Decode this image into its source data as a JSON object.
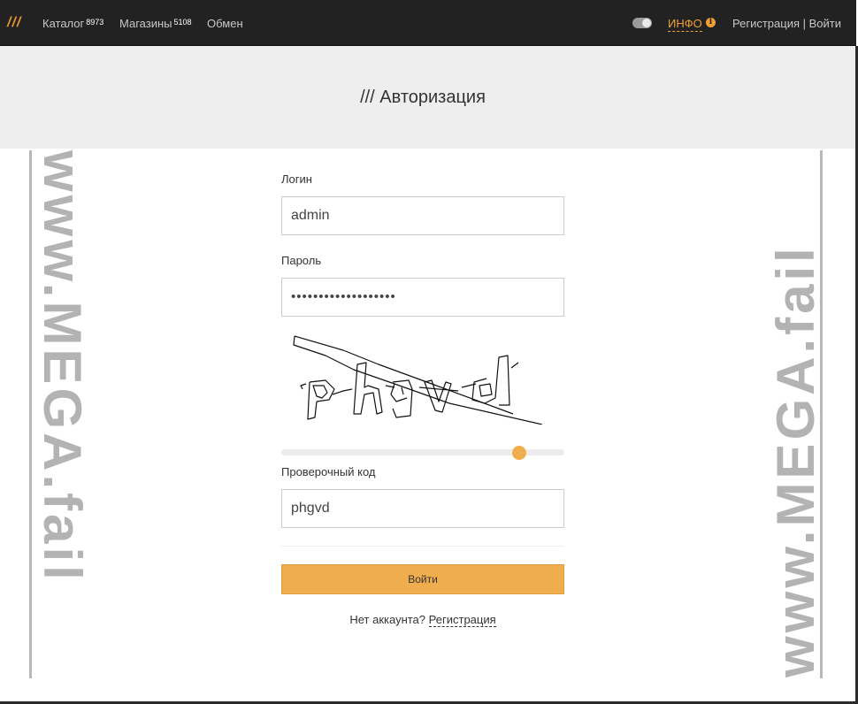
{
  "navbar": {
    "logo": "///",
    "catalog_label": "Каталог",
    "catalog_count": "8973",
    "shops_label": "Магазины",
    "shops_count": "5108",
    "exchange_label": "Обмен",
    "info_label": "ИНФО",
    "info_icon": "info-circle-icon",
    "register_label": "Регистрация",
    "separator": "|",
    "login_label": "Войти"
  },
  "heading": {
    "title": "/// Авторизация"
  },
  "form": {
    "login_label": "Логин",
    "login_value": "admin",
    "password_label": "Пароль",
    "password_value": "•••••••••••••••••••",
    "verification_label": "Проверочный код",
    "verification_value": "phgvd",
    "submit_label": "Войти",
    "no_account_text": "Нет аккаунта?",
    "register_link": "Регистрация",
    "slider_value": 0.84
  },
  "captcha": {
    "text": "phgvd"
  },
  "watermark": {
    "text": "www.MEGA.fail"
  },
  "colors": {
    "accent": "#f0ad4e",
    "navbar_bg": "#222222",
    "heading_bg": "#eeeeee",
    "watermark": "#b3b3b3"
  }
}
